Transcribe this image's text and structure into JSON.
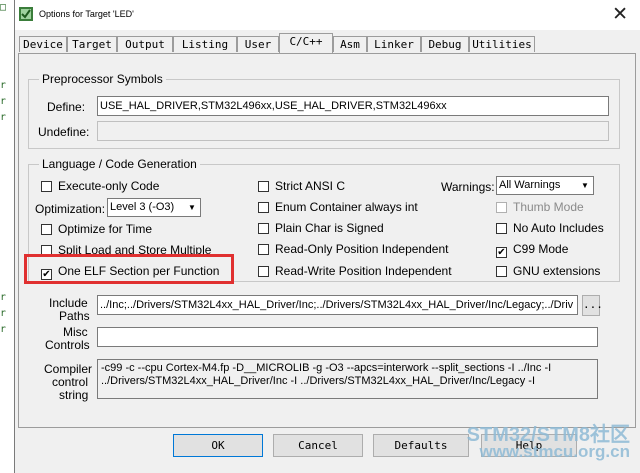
{
  "window": {
    "title": "Options for Target 'LED'",
    "close_glyph": "✕"
  },
  "tabs": [
    {
      "label": "Device"
    },
    {
      "label": "Target"
    },
    {
      "label": "Output"
    },
    {
      "label": "Listing"
    },
    {
      "label": "User"
    },
    {
      "label": "C/C++",
      "active": true
    },
    {
      "label": "Asm"
    },
    {
      "label": "Linker"
    },
    {
      "label": "Debug"
    },
    {
      "label": "Utilities"
    }
  ],
  "preprocessor": {
    "legend": "Preprocessor Symbols",
    "define_label": "Define:",
    "define_value": "USE_HAL_DRIVER,STM32L496xx,USE_HAL_DRIVER,STM32L496xx",
    "undefine_label": "Undefine:",
    "undefine_value": ""
  },
  "language": {
    "legend": "Language / Code Generation",
    "execute_only": {
      "label": "Execute-only Code",
      "checked": false
    },
    "optimization_label": "Optimization:",
    "optimization_value": "Level 3 (-O3)",
    "optimize_time": {
      "label": "Optimize for Time",
      "checked": false
    },
    "split_load": {
      "label": "Split Load and Store Multiple",
      "checked": false
    },
    "one_elf": {
      "label": "One ELF Section per Function",
      "checked": true
    },
    "strict_ansi": {
      "label": "Strict ANSI C",
      "checked": false
    },
    "enum_container": {
      "label": "Enum Container always int",
      "checked": false
    },
    "plain_char": {
      "label": "Plain Char is Signed",
      "checked": false
    },
    "ropi": {
      "label": "Read-Only Position Independent",
      "checked": false
    },
    "rwpi": {
      "label": "Read-Write Position Independent",
      "checked": false
    },
    "warnings_label": "Warnings:",
    "warnings_value": "All Warnings",
    "thumb_mode": {
      "label": "Thumb Mode",
      "checked": false,
      "disabled": true
    },
    "no_auto_includes": {
      "label": "No Auto Includes",
      "checked": false
    },
    "c99_mode": {
      "label": "C99 Mode",
      "checked": true
    },
    "gnu_extensions": {
      "label": "GNU extensions",
      "checked": false
    }
  },
  "include": {
    "label_line1": "Include",
    "label_line2": "Paths",
    "value": "../Inc;../Drivers/STM32L4xx_HAL_Driver/Inc;../Drivers/STM32L4xx_HAL_Driver/Inc/Legacy;../Driv",
    "browse_label": "..."
  },
  "misc": {
    "label_line1": "Misc",
    "label_line2": "Controls",
    "value": ""
  },
  "compiler": {
    "label_line1": "Compiler",
    "label_line2": "control",
    "label_line3": "string",
    "line1": "-c99 -c --cpu Cortex-M4.fp -D__MICROLIB -g -O3 --apcs=interwork --split_sections -I ../Inc -I",
    "line2": "../Drivers/STM32L4xx_HAL_Driver/Inc -I ../Drivers/STM32L4xx_HAL_Driver/Inc/Legacy -I"
  },
  "buttons": {
    "ok": "OK",
    "cancel": "Cancel",
    "defaults": "Defaults",
    "help": "Help"
  },
  "watermark": {
    "line1": "STM32/STM8社区",
    "line2": "www.stmcu.org.cn"
  },
  "colors": {
    "highlight": "#e03030",
    "accent": "#0078d7"
  }
}
